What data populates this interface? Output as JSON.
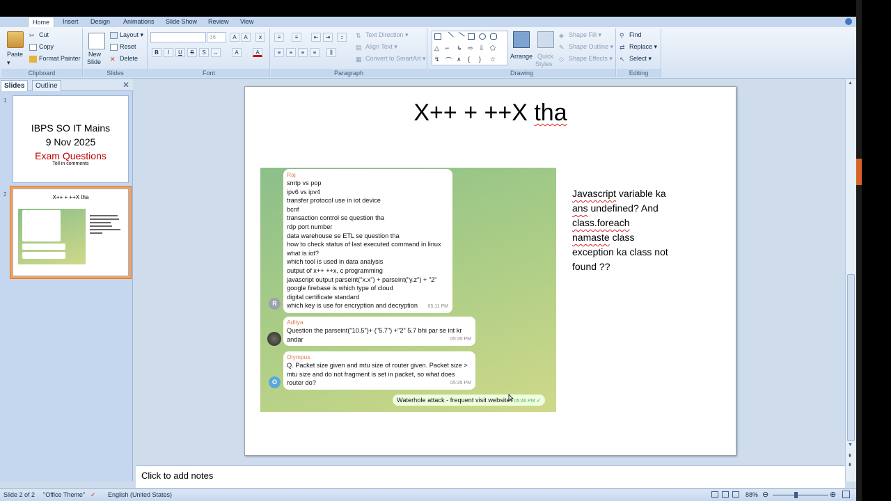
{
  "ribbon_tabs": [
    "Home",
    "Insert",
    "Design",
    "Animations",
    "Slide Show",
    "Review",
    "View"
  ],
  "clipboard": {
    "paste": "Paste",
    "cut": "Cut",
    "copy": "Copy",
    "format_painter": "Format Painter",
    "label": "Clipboard"
  },
  "slides_group": {
    "new_slide": "New",
    "new_slide2": "Slide",
    "layout": "Layout",
    "reset": "Reset",
    "delete": "Delete",
    "label": "Slides"
  },
  "font_group": {
    "size": "36",
    "label": "Font"
  },
  "paragraph_group": {
    "text_direction": "Text Direction",
    "align_text": "Align Text",
    "convert_smartart": "Convert to SmartArt",
    "label": "Paragraph"
  },
  "drawing_group": {
    "arrange": "Arrange",
    "quick_styles": "Quick",
    "quick_styles2": "Styles",
    "shape_fill": "Shape Fill",
    "shape_outline": "Shape Outline",
    "shape_effects": "Shape Effects",
    "label": "Drawing"
  },
  "editing_group": {
    "find": "Find",
    "replace": "Replace",
    "select": "Select",
    "label": "Editing"
  },
  "panel_tabs": {
    "slides": "Slides",
    "outline": "Outline"
  },
  "thumbnails": [
    {
      "num": "1",
      "line1": "IBPS SO IT Mains",
      "line2": "9 Nov 2025",
      "line3": "Exam Questions",
      "line4": "Tell in comments"
    },
    {
      "num": "2",
      "title": "X++ + ++X tha"
    }
  ],
  "slide": {
    "title_part1": "X++ + ++X ",
    "title_part2": "tha",
    "side_text_lines": [
      {
        "text": "Javascript",
        "squiggle": true,
        "rest": " variable ka"
      },
      {
        "text": "ans",
        "squiggle": true,
        "rest": " undefined? And"
      },
      {
        "text": "class.foreach",
        "squiggle": true,
        "rest": ""
      },
      {
        "text": "namaste",
        "squiggle": true,
        "rest": " class"
      },
      {
        "text": "",
        "squiggle": false,
        "rest": "exception ka class not"
      },
      {
        "text": "",
        "squiggle": false,
        "rest": "found ??"
      }
    ]
  },
  "chat": {
    "messages": [
      {
        "sender": "Raj",
        "sender_color": "#e17c52",
        "avatar": "R",
        "avatar_color": "#9aa2ad",
        "lines": [
          "smtp vs pop",
          "ipv6 vs ipv4",
          "transfer protocol use in iot device",
          "bcnf",
          "transaction control se question tha",
          "rdp port number",
          "data warehouse se ETL  se question tha",
          "how to check status of last executed command in linux",
          "what is iot?",
          "which tool is used in data analysis",
          "output of  x++ ++x, c programming",
          "javascript output parseint(\"x.x\") + parseint(\"y.z\") + \"2\"",
          "google firebase is which type of cloud",
          "digital certificate standard",
          "which key is use for encryption and decryption"
        ],
        "time": "05:11 PM"
      },
      {
        "sender": "Aditya",
        "sender_color": "#e17c52",
        "avatar": "",
        "avatar_color": "#3a3f3a",
        "lines": [
          "Question the parseint(\"10.5\")+ (\"5.7\") +\"2\" 5.7 bhi par se int kr",
          "andar"
        ],
        "time": "05:35 PM"
      },
      {
        "sender": "Olympus",
        "sender_color": "#e17c52",
        "avatar": "O",
        "avatar_color": "#5aa8d8",
        "lines": [
          "Q. Packet size given and mtu size of router given. Packet size >",
          "mtu size and do not fragment is set in packet, so what does",
          "router do?"
        ],
        "time": "05:35 PM"
      }
    ],
    "sent": {
      "text": "Waterhole attack - frequent visit website",
      "time": "05:46 PM"
    }
  },
  "notes_placeholder": "Click to add notes",
  "status": {
    "slide_count": "Slide 2 of 2",
    "theme": "\"Office Theme\"",
    "language": "English (United States)",
    "zoom": "88%"
  },
  "colors": {
    "accent_red": "#c00000",
    "thumb_selected": "#f4a25b"
  }
}
